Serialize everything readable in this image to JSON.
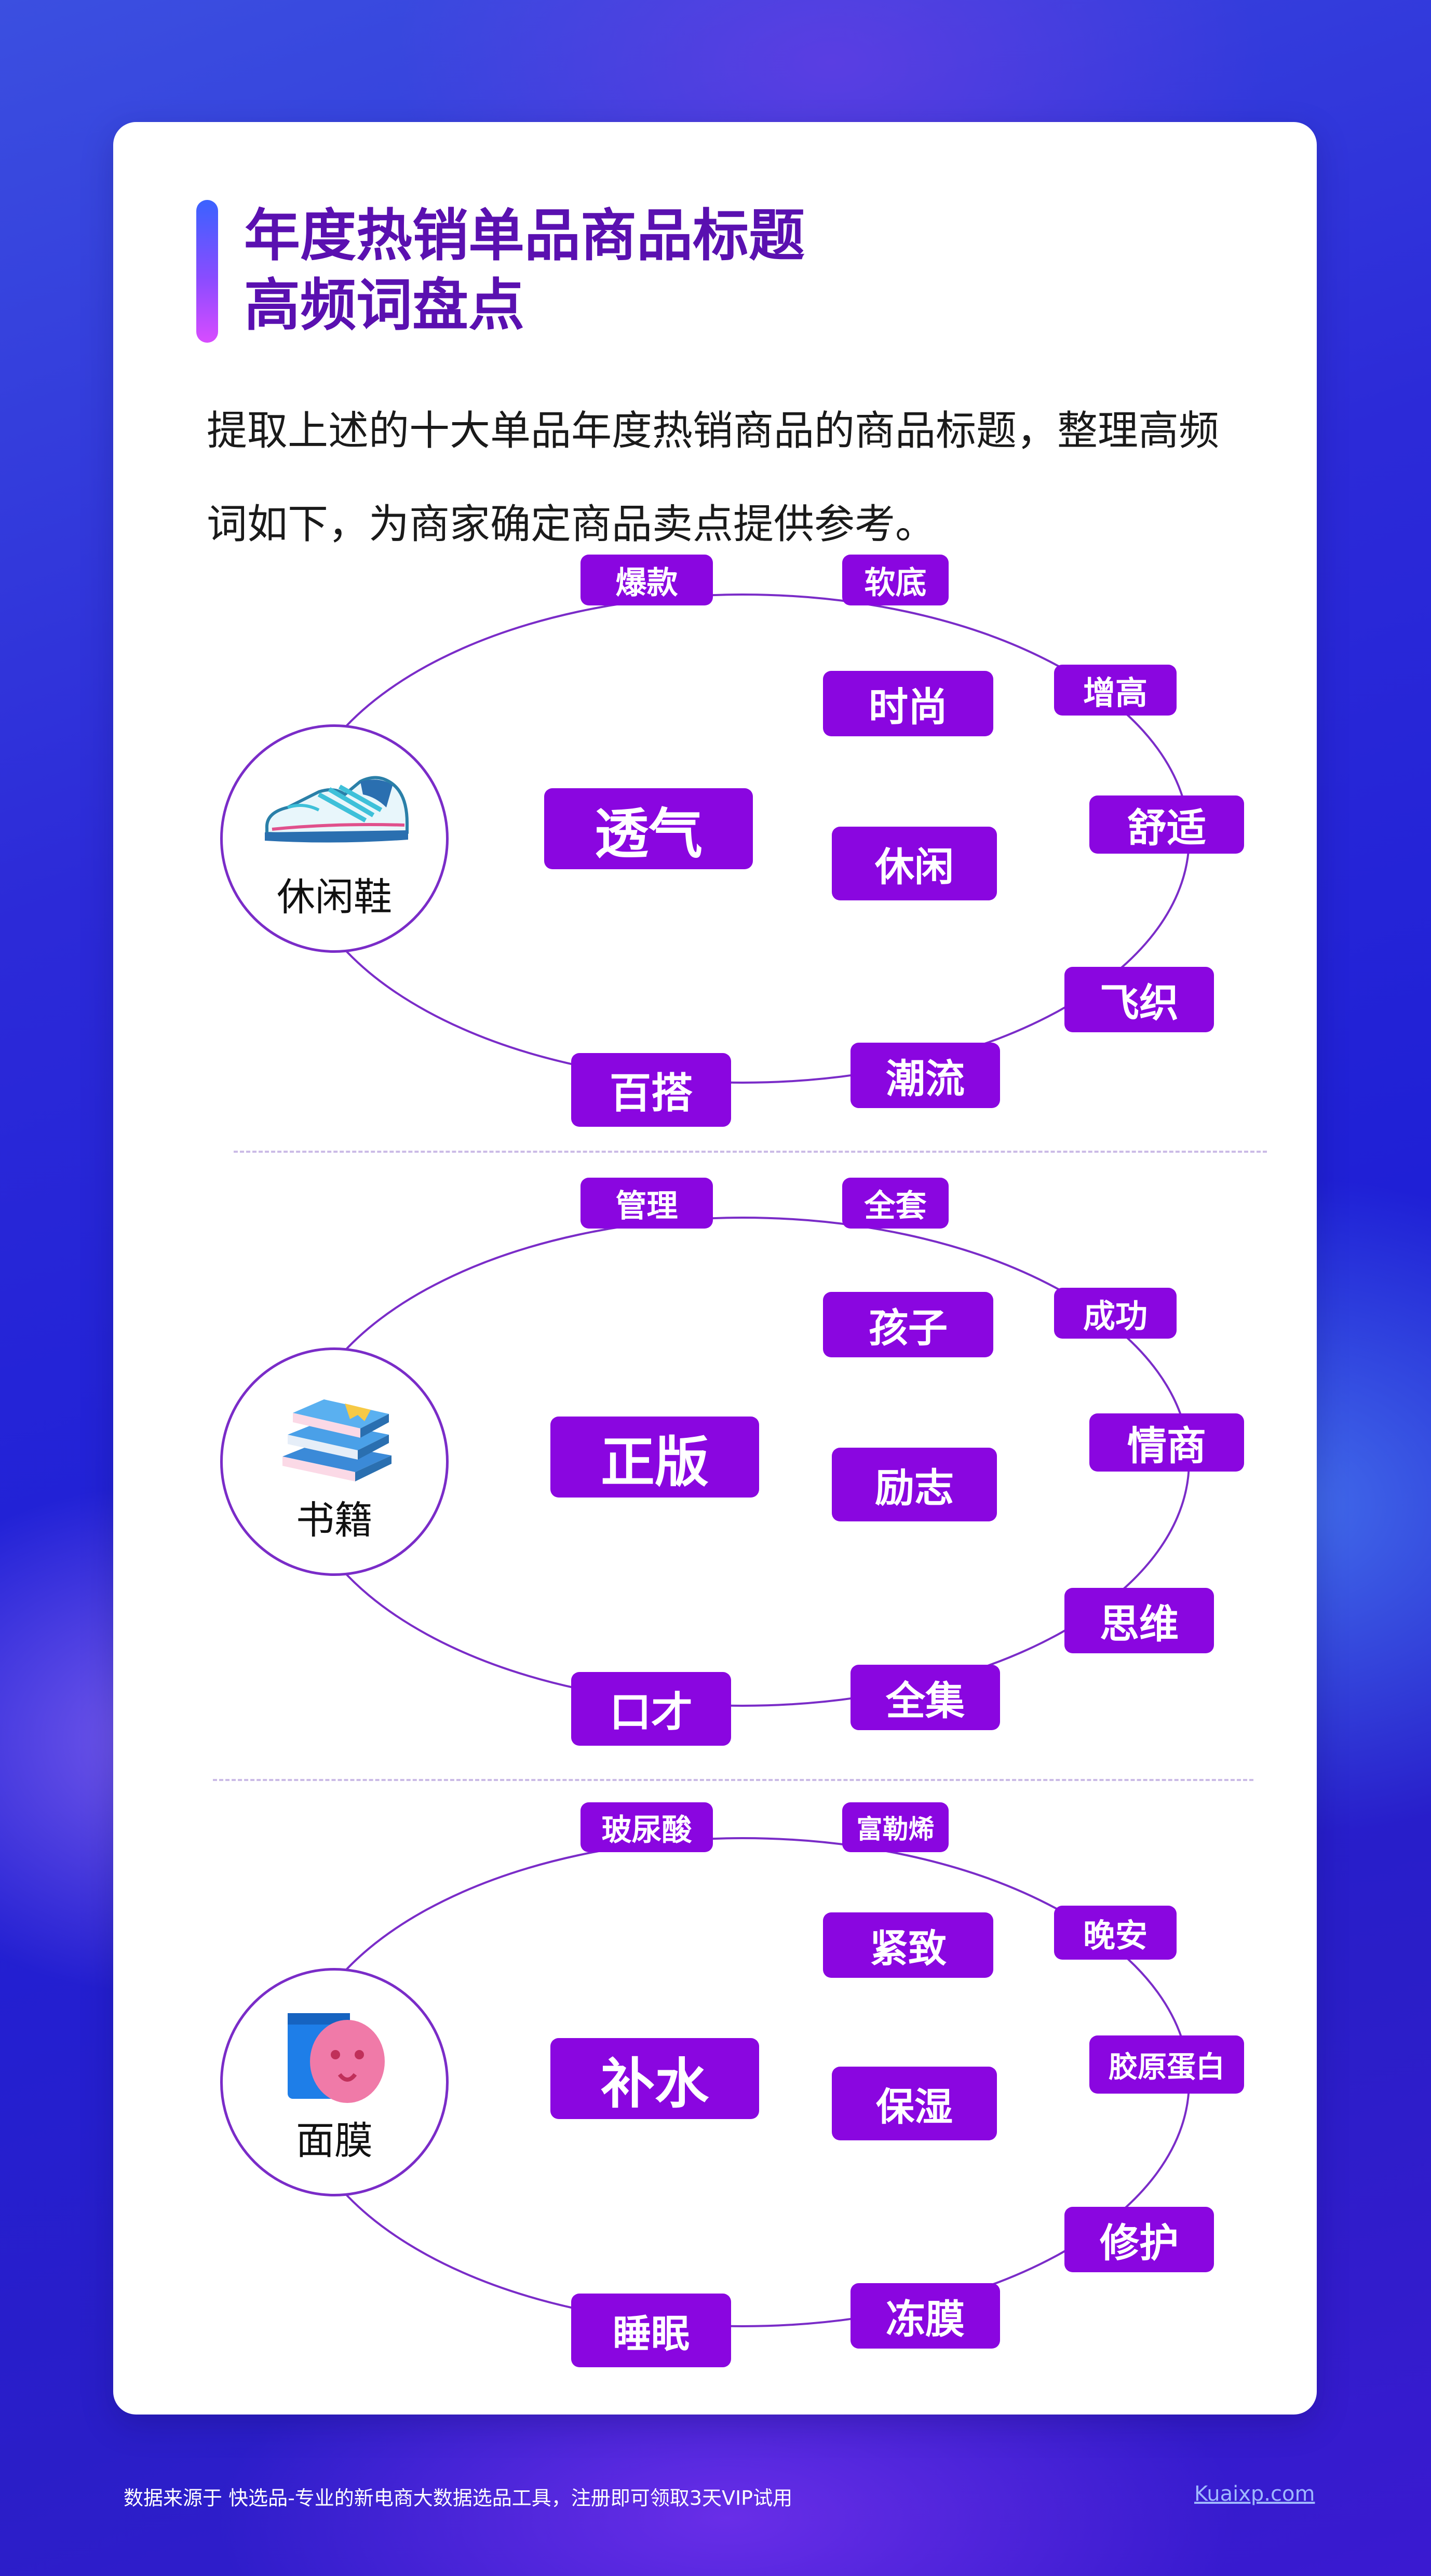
{
  "header": {
    "title_line1": "年度热销单品商品标题",
    "title_line2": "高频词盘点"
  },
  "intro": {
    "line1": "提取上述的十大单品年度热销商品的商品标题，整理高频",
    "line2": "词如下，为商家确定商品卖点提供参考。"
  },
  "sections": [
    {
      "category": "休闲鞋",
      "icon": "sneaker-icon",
      "main_keyword": "透气",
      "keywords": [
        "爆款",
        "软底",
        "增高",
        "舒适",
        "飞织",
        "潮流",
        "百搭",
        "时尚",
        "休闲"
      ]
    },
    {
      "category": "书籍",
      "icon": "books-icon",
      "main_keyword": "正版",
      "keywords": [
        "管理",
        "全套",
        "成功",
        "情商",
        "思维",
        "全集",
        "口才",
        "孩子",
        "励志"
      ]
    },
    {
      "category": "面膜",
      "icon": "face-mask-icon",
      "main_keyword": "补水",
      "keywords": [
        "玻尿酸",
        "富勒烯",
        "晚安",
        "胶原蛋白",
        "修护",
        "冻膜",
        "睡眠",
        "紧致",
        "保湿"
      ]
    }
  ],
  "footer": {
    "source": "数据来源于 快选品-专业的新电商大数据选品工具，注册即可领取3天VIP试用",
    "link": "Kuaixp.com"
  },
  "colors": {
    "tag_purple": "#8a06e0",
    "title_purple": "#5a10b0",
    "ring_purple": "#7a2cc8"
  }
}
